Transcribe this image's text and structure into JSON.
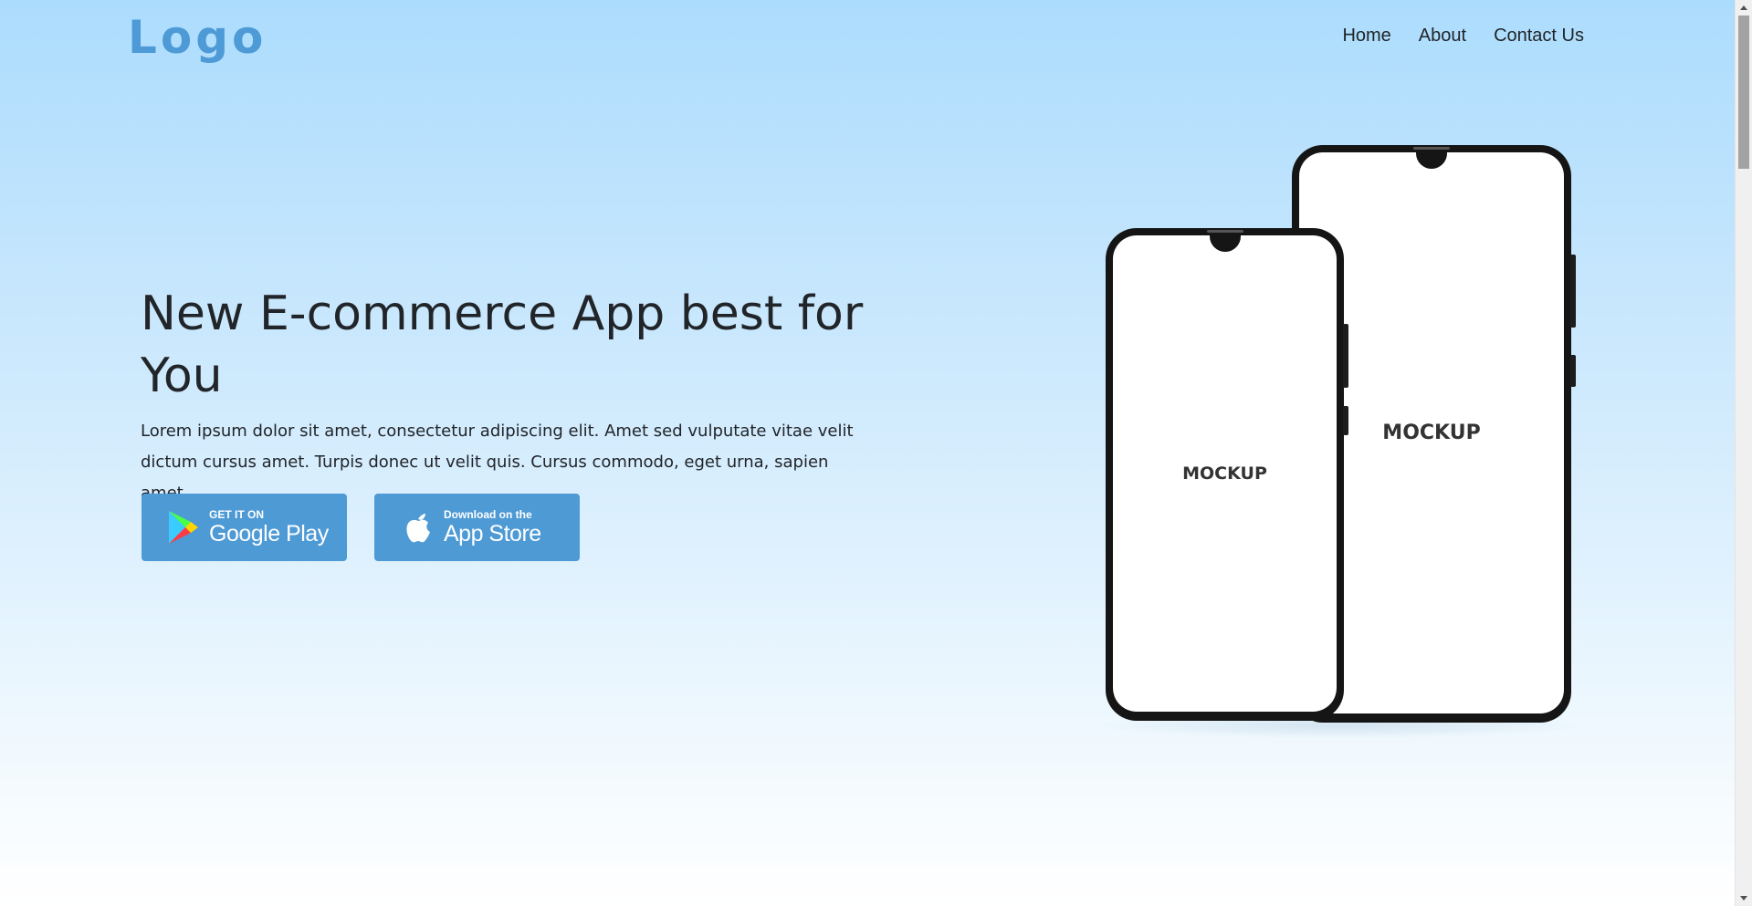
{
  "header": {
    "logo": "Logo",
    "nav": [
      {
        "label": "Home"
      },
      {
        "label": "About"
      },
      {
        "label": "Contact Us"
      }
    ]
  },
  "hero": {
    "title": "New E-commerce App best for You",
    "text": "Lorem ipsum dolor sit amet, consectetur adipiscing elit. Amet sed vulputate vitae velit dictum cursus amet. Turpis donec ut velit quis. Cursus commodo, eget urna, sapien amet.",
    "buttons": {
      "google": {
        "small": "GET IT ON",
        "big": "Google Play",
        "icon": "google-play-icon"
      },
      "apple": {
        "small": "Download on the",
        "big": "App Store",
        "icon": "apple-icon"
      }
    }
  },
  "mockup": {
    "front_label": "MOCKUP",
    "back_label": "MOCKUP"
  },
  "colors": {
    "accent": "#4e9ad5",
    "background_top": "#acdcfd",
    "text": "#212529"
  }
}
